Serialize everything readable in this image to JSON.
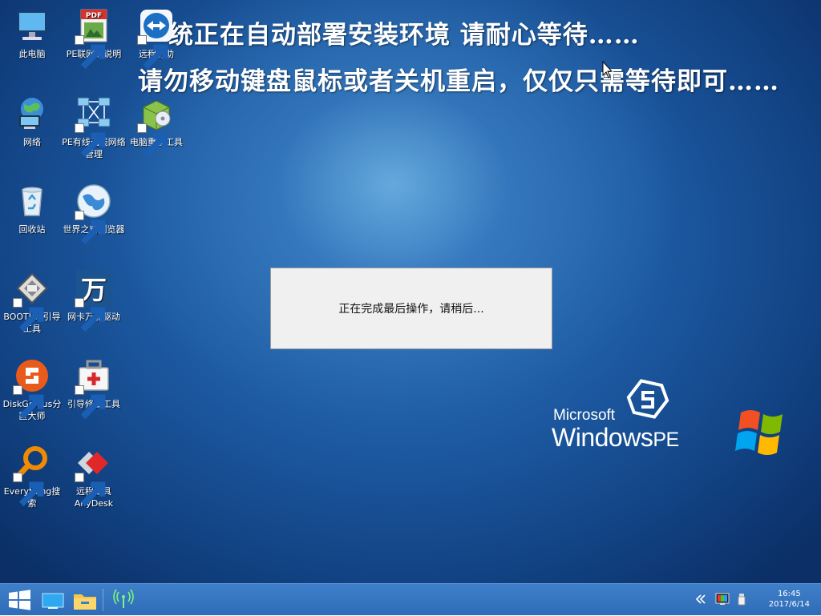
{
  "headlines": {
    "line1": "统正在自动部署安装环境 请耐心等待……",
    "line2": "请勿移动键盘鼠标或者关机重启，仅仅只需等待即可……"
  },
  "desktop_icons": [
    {
      "label": "此电脑",
      "icon": "computer-icon"
    },
    {
      "label": "PE联网等说明",
      "icon": "pdf-document-icon"
    },
    {
      "label": "远程协助",
      "icon": "teamviewer-icon"
    },
    {
      "label": "网络",
      "icon": "network-globe-icon"
    },
    {
      "label": "PE有线无线网络管理",
      "icon": "network-manager-icon"
    },
    {
      "label": "电脑重装工具",
      "icon": "installer-box-icon"
    },
    {
      "label": "回收站",
      "icon": "recycle-bin-icon"
    },
    {
      "label": "世界之窗浏览器",
      "icon": "browser-globe-icon"
    },
    {
      "label": "BOOTICE引导工具",
      "icon": "bootice-icon"
    },
    {
      "label": "网卡万能驱动",
      "icon": "wan-driver-icon"
    },
    {
      "label": "DiskGenius分区大师",
      "icon": "diskgenius-icon"
    },
    {
      "label": "引导修复工具",
      "icon": "boot-repair-kit-icon"
    },
    {
      "label": "Everything搜索",
      "icon": "everything-search-icon"
    },
    {
      "label": "远程工具AnyDesk",
      "icon": "anydesk-icon"
    }
  ],
  "dialog": {
    "message": "正在完成最后操作，请稍后..."
  },
  "branding": {
    "microsoft": "Microsoft",
    "windows": "Windows",
    "pe": "PE"
  },
  "taskbar": {
    "start_icon": "windows-start-icon",
    "apps": [
      "desktop-icon",
      "file-explorer-icon",
      "network-signal-icon"
    ]
  },
  "tray": {
    "time": "16:45",
    "date": "2017/6/14"
  },
  "colors": {
    "desktop_blue": "#1d5aa2",
    "taskbar_blue": "#3474bf",
    "dialog_bg": "#f0f0f0"
  }
}
